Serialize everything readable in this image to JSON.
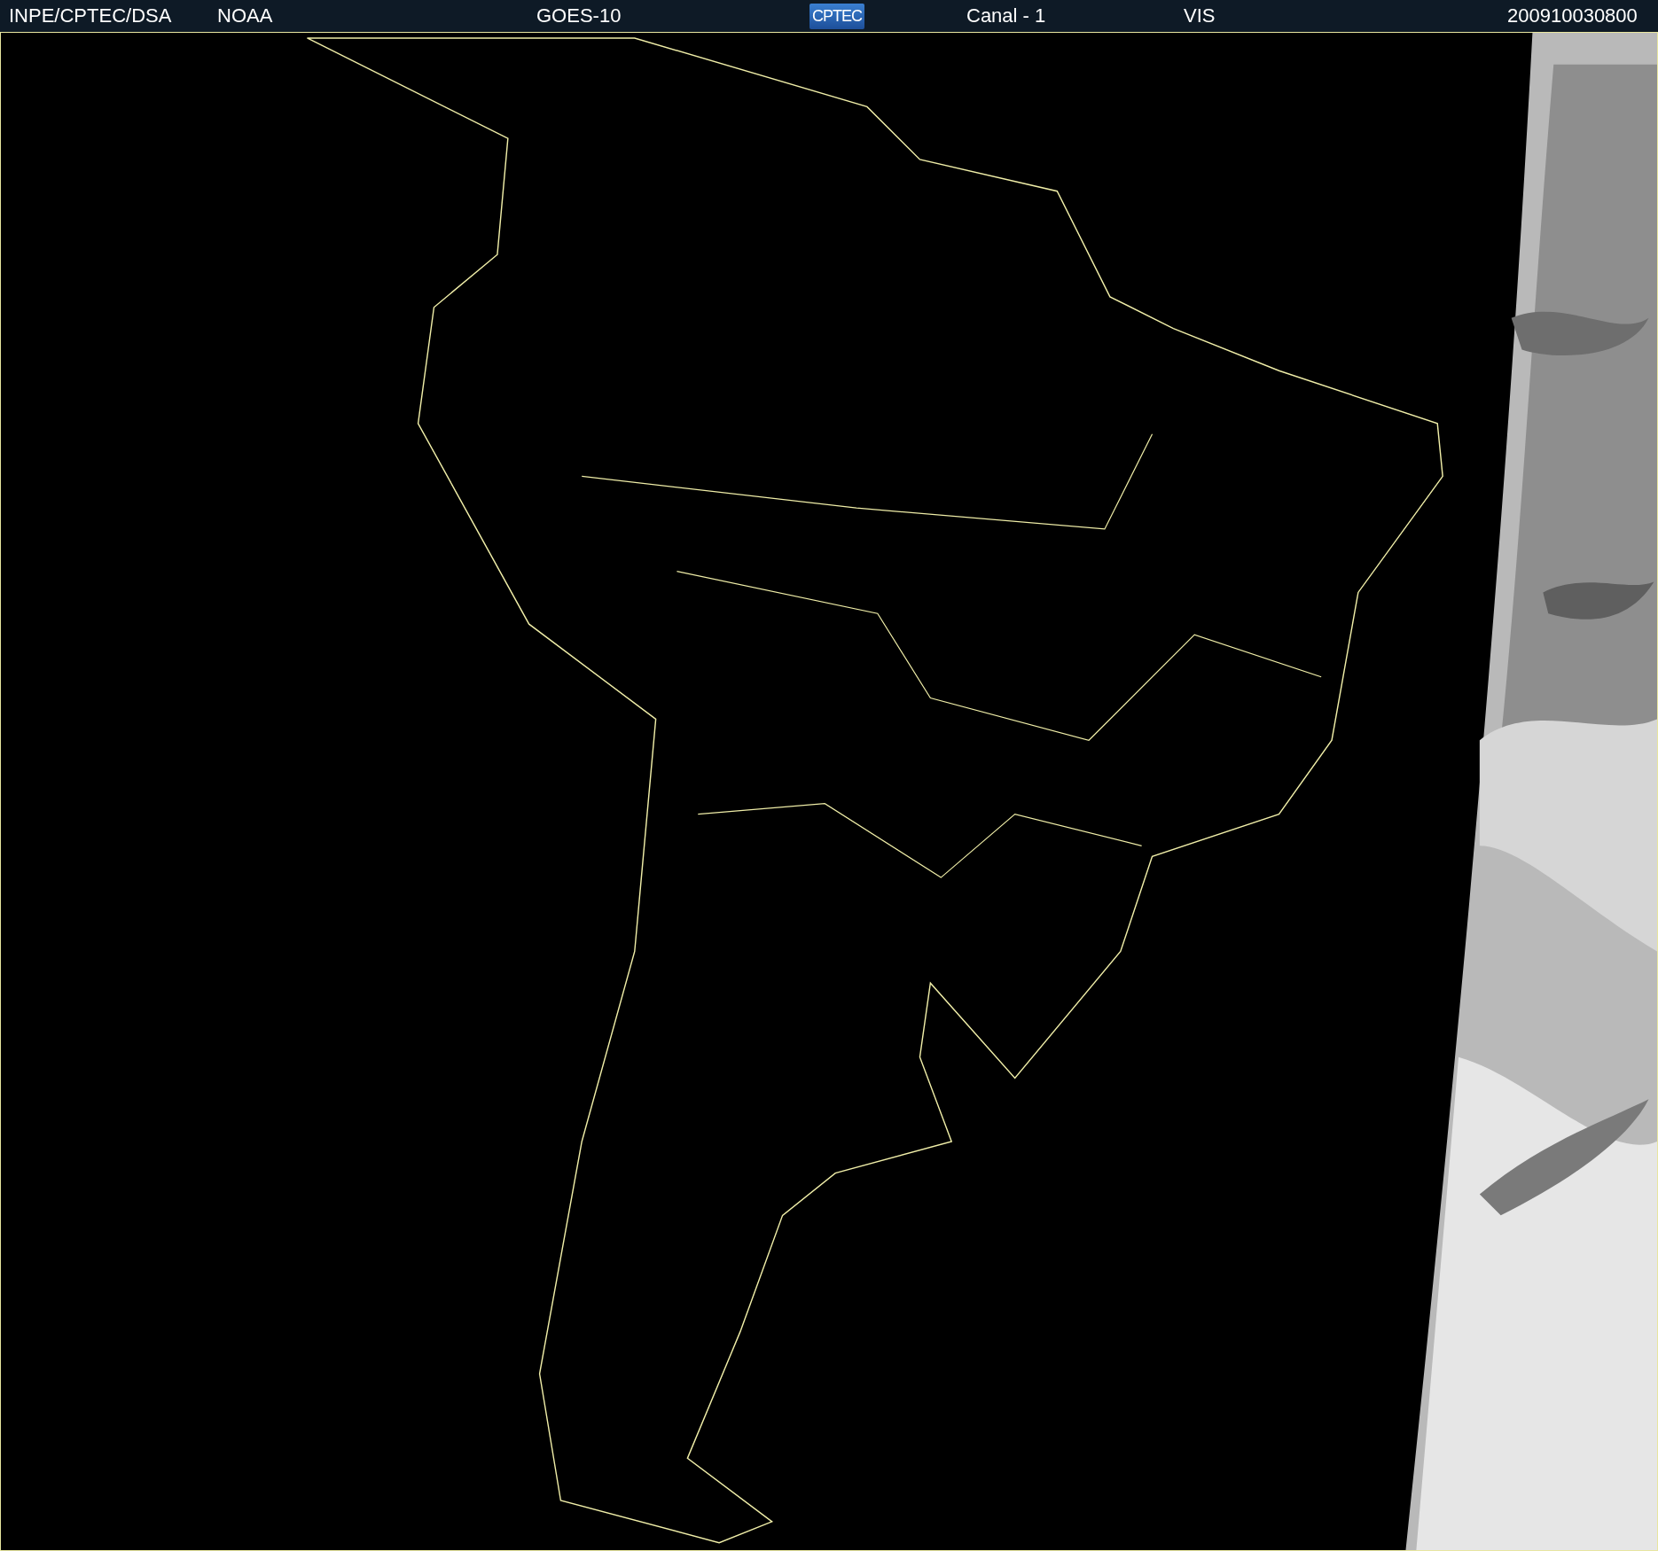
{
  "header": {
    "items": [
      {
        "kind": "text",
        "text": "INPE/CPTEC/DSA"
      },
      {
        "kind": "text",
        "text": "NOAA"
      },
      {
        "kind": "text",
        "text": "GOES-10"
      },
      {
        "kind": "logo",
        "text": "CPTEC"
      },
      {
        "kind": "text",
        "text": "Canal - 1"
      },
      {
        "kind": "text",
        "text": "VIS"
      },
      {
        "kind": "text",
        "text": "200910030800"
      }
    ]
  }
}
